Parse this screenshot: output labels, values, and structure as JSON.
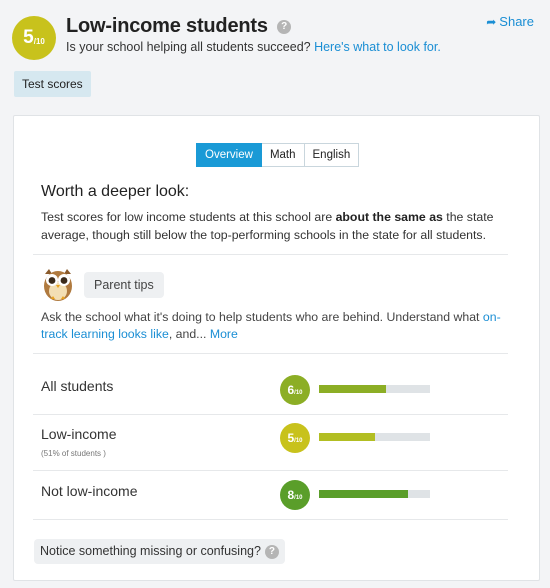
{
  "header": {
    "score_value": "5",
    "score_denominator": "/10",
    "title": "Low-income students",
    "help_icon": "question-circle-icon",
    "subtitle": "Is your school helping all students succeed?",
    "subtitle_link": "Here's what to look for.",
    "share_label": "Share",
    "share_icon": "share-arrow-icon"
  },
  "tab": {
    "label": "Test scores"
  },
  "toggle": {
    "options": [
      "Overview",
      "Math",
      "English"
    ],
    "selected": "Overview"
  },
  "summary": {
    "heading": "Worth a deeper look:",
    "text_before": "Test scores for low income students at this school are ",
    "text_bold": "about the same as",
    "text_after": " the state average, though still below the top-performing schools in the state for all students."
  },
  "parent_tips": {
    "icon": "owl-icon",
    "label": "Parent tips",
    "text_before": "Ask the school what it's doing to help students who are behind. Understand what ",
    "link": "on-track learning looks like",
    "text_after": ", and... ",
    "more_link": "More"
  },
  "ratings": [
    {
      "label": "All students",
      "note": "",
      "score": "6",
      "denominator": "/10",
      "fraction": 0.6,
      "color": "#8cae25",
      "badge_color": "#8cae25"
    },
    {
      "label": "Low-income",
      "note": "(51% of students )",
      "score": "5",
      "denominator": "/10",
      "fraction": 0.5,
      "color": "#b2be22",
      "badge_color": "#c8c21c"
    },
    {
      "label": "Not low-income",
      "note": "",
      "score": "8",
      "denominator": "/10",
      "fraction": 0.8,
      "color": "#5a9e2a",
      "badge_color": "#5a9e2a"
    }
  ],
  "feedback": {
    "label": "Notice something missing or confusing?"
  }
}
